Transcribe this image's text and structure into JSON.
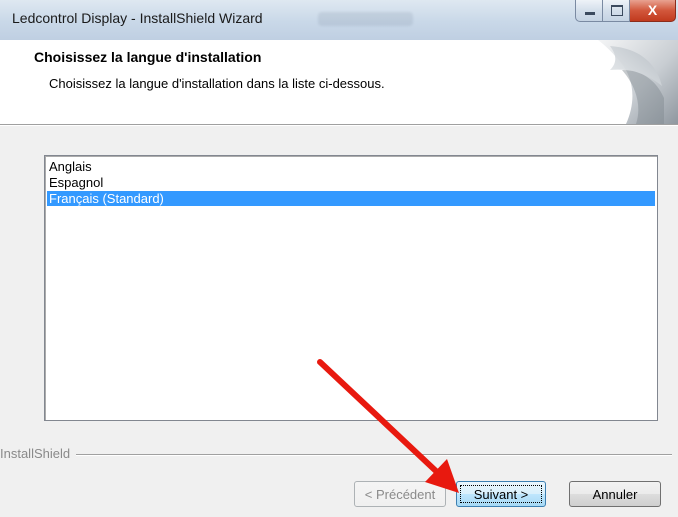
{
  "window": {
    "title": "Ledcontrol Display - InstallShield Wizard",
    "close_glyph": "X"
  },
  "header": {
    "title": "Choisissez la langue d'installation",
    "subtitle": "Choisissez la langue d'installation dans la liste ci-dessous."
  },
  "language_list": {
    "items": [
      {
        "label": "Anglais",
        "selected": false
      },
      {
        "label": "Espagnol",
        "selected": false
      },
      {
        "label": "Français (Standard)",
        "selected": true
      }
    ]
  },
  "brand": {
    "label": "InstallShield"
  },
  "buttons": {
    "previous": "< Précédent",
    "next": "Suivant >",
    "cancel": "Annuler"
  },
  "colors": {
    "selection": "#3399ff",
    "annotation_arrow": "#e8190f"
  },
  "icons": [
    "minimize-icon",
    "maximize-icon",
    "close-icon",
    "header-graphic"
  ]
}
